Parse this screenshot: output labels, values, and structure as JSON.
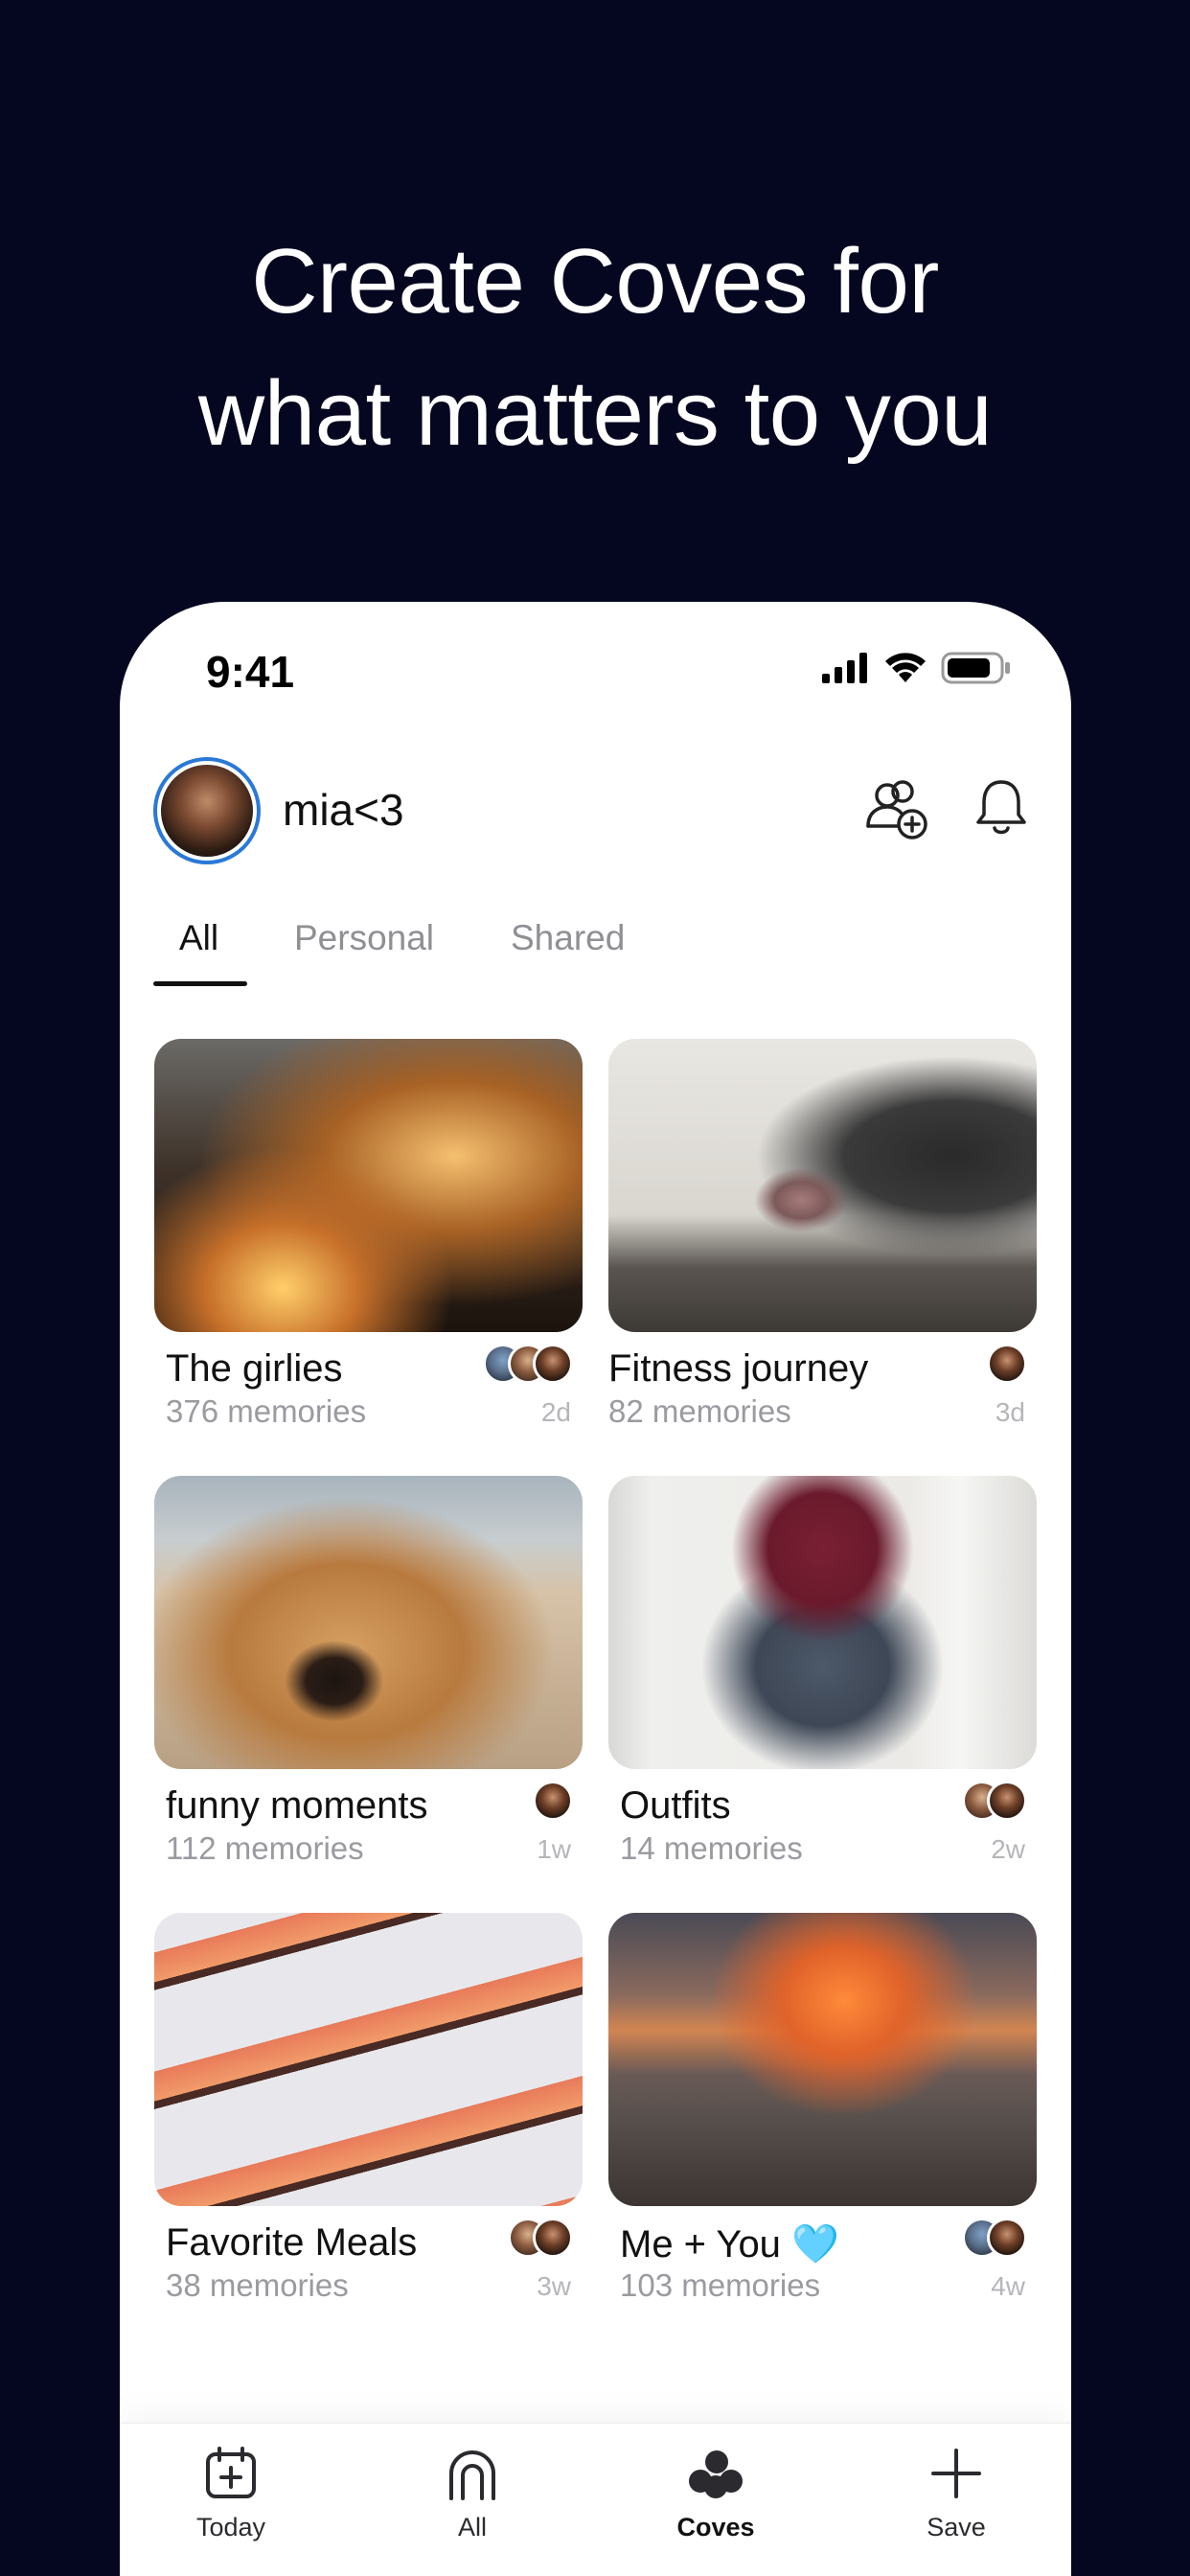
{
  "headline": {
    "line1": "Create Coves for",
    "line2": "what matters to you"
  },
  "status_bar": {
    "time": "9:41",
    "icons": [
      "signal-icon",
      "wifi-icon",
      "battery-icon"
    ]
  },
  "header": {
    "username": "mia<3",
    "icons": [
      "add-friends-icon",
      "bell-icon"
    ]
  },
  "tabs": [
    {
      "label": "All",
      "active": true
    },
    {
      "label": "Personal",
      "active": false
    },
    {
      "label": "Shared",
      "active": false
    }
  ],
  "coves": [
    {
      "title": "The girlies",
      "memories": "376 memories",
      "age": "2d",
      "avatars": 3
    },
    {
      "title": "Fitness journey",
      "memories": "82 memories",
      "age": "3d",
      "avatars": 1
    },
    {
      "title": "funny moments",
      "memories": "112 memories",
      "age": "1w",
      "avatars": 1
    },
    {
      "title": "Outfits",
      "memories": "14 memories",
      "age": "2w",
      "avatars": 2
    },
    {
      "title": "Favorite Meals",
      "memories": "38 memories",
      "age": "3w",
      "avatars": 2
    },
    {
      "title": "Me + You 🩵",
      "memories": "103 memories",
      "age": "4w",
      "avatars": 2
    }
  ],
  "tab_bar": [
    {
      "label": "Today",
      "icon": "calendar-plus-icon",
      "active": false
    },
    {
      "label": "All",
      "icon": "arch-icon",
      "active": false
    },
    {
      "label": "Coves",
      "icon": "coves-icon",
      "active": true
    },
    {
      "label": "Save",
      "icon": "plus-icon",
      "active": false
    }
  ],
  "colors": {
    "background": "#05061f",
    "avatar_ring": "#2a78d8",
    "muted_text": "#9a9aa0"
  }
}
